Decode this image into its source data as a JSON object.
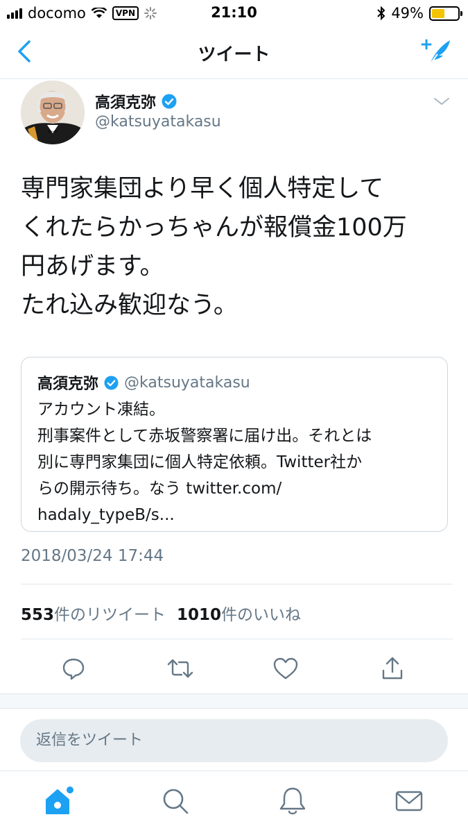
{
  "status_bar": {
    "carrier": "docomo",
    "vpn": "VPN",
    "time": "21:10",
    "battery": "49%",
    "battery_level": 0.49
  },
  "nav": {
    "title": "ツイート",
    "back_icon": "chevron-left-icon",
    "compose_icon": "compose-quill-icon"
  },
  "tweet": {
    "display_name": "高須克弥",
    "handle": "@katsuyatakasu",
    "text": "専門家集団より早く個人特定して\nくれたらかっちゃんが報償金100万\n円あげます。\nたれ込み歓迎なう。",
    "timestamp": "2018/03/24 17:44"
  },
  "quoted_tweet": {
    "display_name": "高須克弥",
    "handle": "@katsuyatakasu",
    "text": "アカウント凍結。\n刑事案件として赤坂警察署に届け出。それとは\n別に専門家集団に個人特定依頼。Twitter社か\nらの開示待ち。なう twitter.com/\nhadaly_typeB/s..."
  },
  "stats": {
    "retweet_count": "553",
    "retweet_label": "件のリツイート",
    "like_count": "1010",
    "like_label": "件のいいね"
  },
  "reply": {
    "placeholder": "返信をツイート"
  },
  "colors": {
    "accent": "#1da1f2",
    "secondary_text": "#657786",
    "border": "#e1e8ed"
  }
}
